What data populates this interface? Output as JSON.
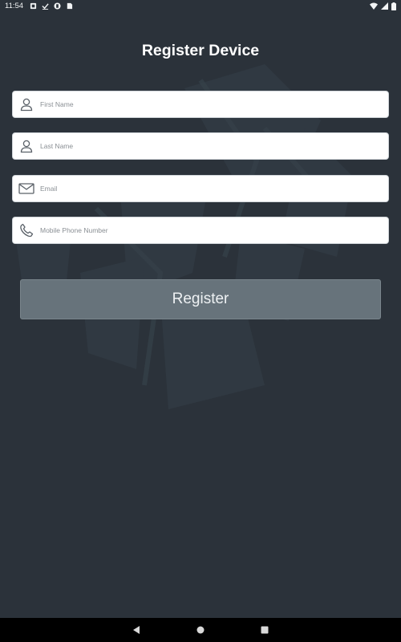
{
  "status_bar": {
    "time": "11:54",
    "left_icons": [
      "notification-icon",
      "download-done-icon",
      "app-icon",
      "sim-icon"
    ],
    "right_icons": [
      "wifi-icon",
      "signal-icon",
      "battery-icon"
    ]
  },
  "page": {
    "title": "Register Device"
  },
  "form": {
    "first_name": {
      "placeholder": "First Name",
      "value": "",
      "icon": "person-icon"
    },
    "last_name": {
      "placeholder": "Last Name",
      "value": "",
      "icon": "person-icon"
    },
    "email": {
      "placeholder": "Email",
      "value": "",
      "icon": "mail-icon"
    },
    "phone": {
      "placeholder": "Mobile Phone Number",
      "value": "",
      "icon": "phone-icon"
    },
    "register_label": "Register"
  },
  "nav_bar": {
    "buttons": [
      "back-icon",
      "home-icon",
      "recents-icon"
    ]
  },
  "colors": {
    "background": "#2b323a",
    "button": "#67737b",
    "field": "#ffffff"
  }
}
